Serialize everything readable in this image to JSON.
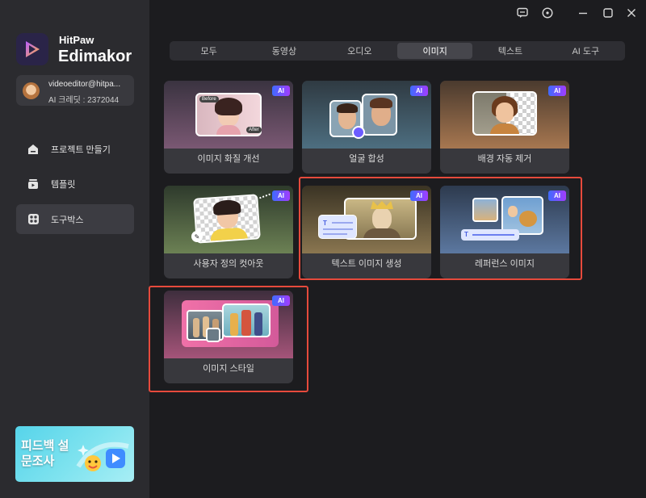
{
  "app": {
    "brand_top": "HitPaw",
    "brand_bottom": "Edimakor"
  },
  "account": {
    "email": "videoeditor@hitpa...",
    "credit": "AI 크레딧 : 2372044"
  },
  "sidebar": {
    "items": [
      {
        "label": "프로젝트 만들기",
        "icon": "home-icon",
        "active": false
      },
      {
        "label": "템플릿",
        "icon": "template-icon",
        "active": false
      },
      {
        "label": "도구박스",
        "icon": "toolbox-icon",
        "active": true
      }
    ],
    "feedback": "피드백 설문조사"
  },
  "titlebar": {
    "icons": [
      "feedback-icon",
      "info-icon",
      "minimize-icon",
      "maximize-icon",
      "close-icon"
    ]
  },
  "tabs": [
    {
      "label": "모두",
      "active": false
    },
    {
      "label": "동영상",
      "active": false
    },
    {
      "label": "오디오",
      "active": false
    },
    {
      "label": "이미지",
      "active": true
    },
    {
      "label": "텍스트",
      "active": false
    },
    {
      "label": "AI 도구",
      "active": false
    }
  ],
  "cards": [
    {
      "label": "이미지 화질 개선",
      "badge": "AI",
      "before_tag": "Before",
      "after_tag": "After"
    },
    {
      "label": "얼굴 합성",
      "badge": "AI"
    },
    {
      "label": "배경 자동 제거",
      "badge": "AI"
    },
    {
      "label": "사용자 정의 컷아웃",
      "badge": "AI"
    },
    {
      "label": "텍스트 이미지 생성",
      "badge": "AI"
    },
    {
      "label": "레퍼런스 이미지",
      "badge": "AI"
    },
    {
      "label": "이미지 스타일",
      "badge": "AI"
    }
  ],
  "colors": {
    "highlight": "#e64a3c",
    "accent_ai": "#6a4dff",
    "active_tab": "#46464c"
  }
}
